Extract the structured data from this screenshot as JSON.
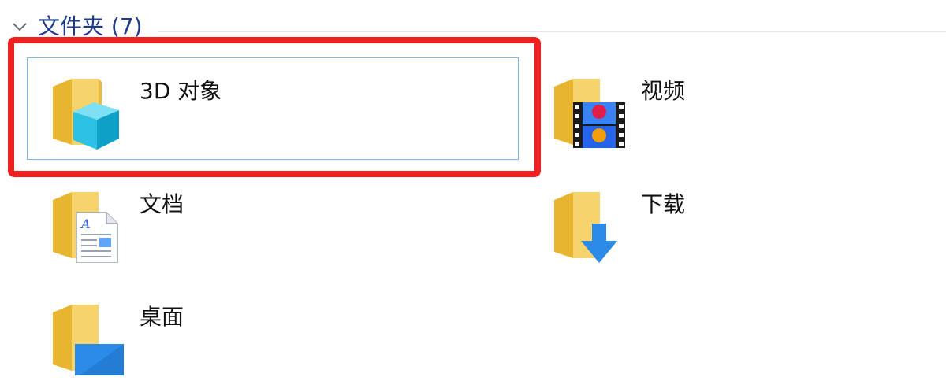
{
  "group": {
    "title": "文件夹 (7)"
  },
  "folders": [
    {
      "label": "3D 对象",
      "icon": "3d-objects-folder-icon",
      "selected": true
    },
    {
      "label": "视频",
      "icon": "videos-folder-icon"
    },
    {
      "label": "文档",
      "icon": "documents-folder-icon"
    },
    {
      "label": "下载",
      "icon": "downloads-folder-icon"
    },
    {
      "label": "桌面",
      "icon": "desktop-folder-icon"
    }
  ],
  "colors": {
    "folder": "#f5c842",
    "selection_border": "#7fb6e6",
    "highlight": "#ef2020",
    "group_title": "#1e3a8a"
  }
}
